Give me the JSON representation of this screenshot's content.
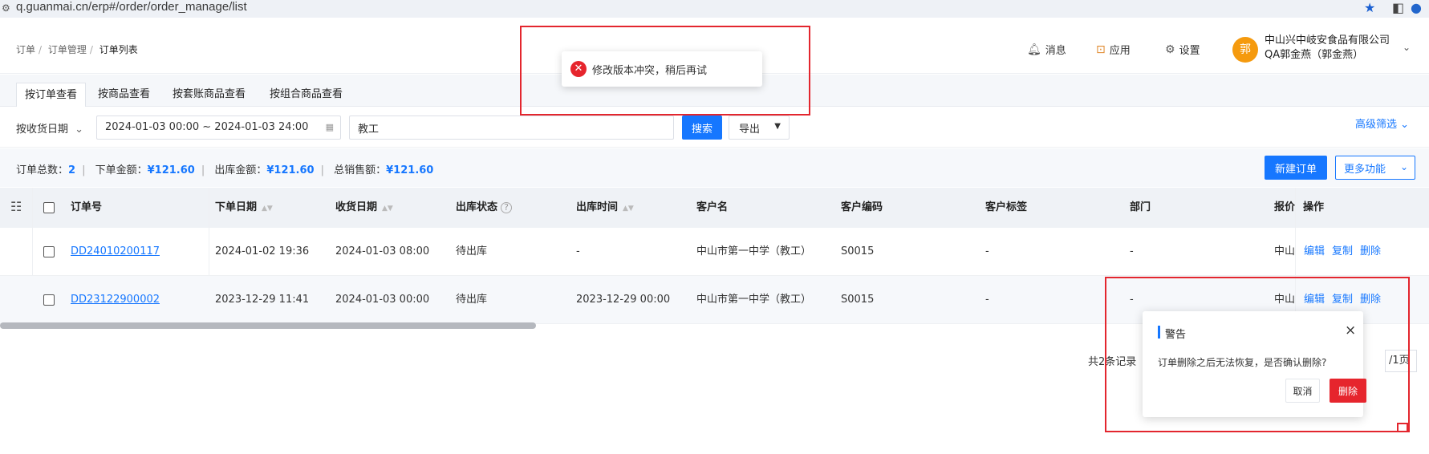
{
  "browser": {
    "url": "q.guanmai.cn/erp#/order/order_manage/list",
    "icons": [
      "site-info-icon",
      "star-icon",
      "sidebar-icon",
      "profile-icon",
      "menu-icon"
    ]
  },
  "breadcrumb": [
    "订单",
    "订单管理",
    "订单列表"
  ],
  "header": {
    "message_label": "消息",
    "apps_label": "应用",
    "settings_label": "设置",
    "avatar_text": "郭",
    "company": "中山兴中岐安食品有限公司",
    "user": "QA郭金燕（郭金燕）"
  },
  "tabs": [
    {
      "label": "按订单查看",
      "active": true
    },
    {
      "label": "按商品查看",
      "active": false
    },
    {
      "label": "按套账商品查看",
      "active": false
    },
    {
      "label": "按组合商品查看",
      "active": false
    }
  ],
  "filters": {
    "date_type": "按收货日期",
    "date_range": "2024-01-03 00:00 ~ 2024-01-03 24:00",
    "search_value": "教工",
    "search_button": "搜索",
    "export_button": "导出",
    "advanced_filter": "高级筛选"
  },
  "summary": {
    "total_orders_label": "订单总数：",
    "total_orders": "2",
    "order_amount_label": "下单金额：",
    "order_amount": "¥121.60",
    "outbound_amount_label": "出库金额：",
    "outbound_amount": "¥121.60",
    "sales_amount_label": "总销售额：",
    "sales_amount": "¥121.60",
    "new_order_button": "新建订单",
    "more_button": "更多功能"
  },
  "table": {
    "columns": [
      "订单号",
      "下单日期",
      "收货日期",
      "出库状态",
      "出库时间",
      "客户名",
      "客户编码",
      "客户标签",
      "部门",
      "报价",
      "操作"
    ],
    "rows": [
      {
        "order_no": "DD24010200117",
        "order_date": "2024-01-02 19:36",
        "receive_date": "2024-01-03 08:00",
        "status": "待出库",
        "out_time": "-",
        "customer": "中山市第一中学（教工）",
        "code": "S0015",
        "tag": "-",
        "dept": "-",
        "quote": "中山"
      },
      {
        "order_no": "DD23122900002",
        "order_date": "2023-12-29 11:41",
        "receive_date": "2024-01-03 00:00",
        "status": "待出库",
        "out_time": "2023-12-29 00:00",
        "customer": "中山市第一中学（教工）",
        "code": "S0015",
        "tag": "-",
        "dept": "-",
        "quote": "中山"
      }
    ],
    "actions": [
      "编辑",
      "复制",
      "删除"
    ]
  },
  "pager": {
    "text": "共2条记录",
    "page_text": "/1页"
  },
  "toast": {
    "message": "修改版本冲突，稍后再试"
  },
  "popover": {
    "title": "警告",
    "body": "订单删除之后无法恢复，是否确认删除?",
    "cancel": "取消",
    "confirm": "删除"
  },
  "colors": {
    "primary": "#1677ff",
    "danger": "#e6252d",
    "avatar": "#f59a0e",
    "highlight": "#e3262e"
  }
}
